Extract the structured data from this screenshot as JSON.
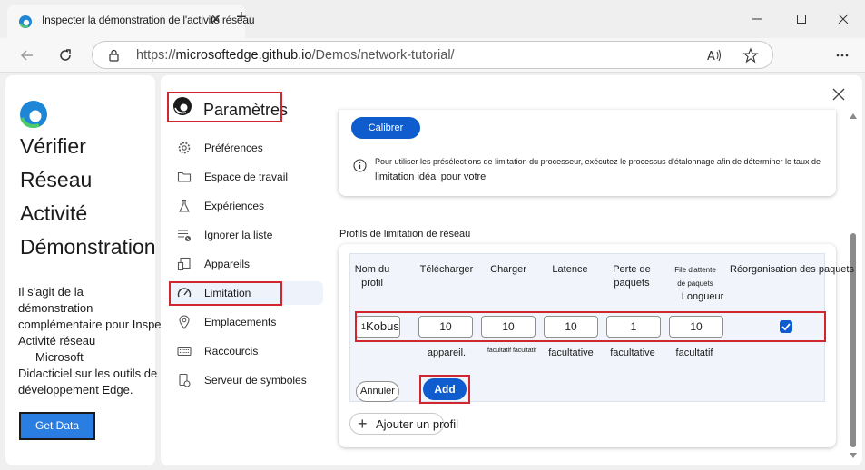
{
  "browser": {
    "tab_title": "Inspecter la démonstration de l'activité réseau",
    "url_prefix": "https://",
    "url_host": "microsoftedge.github.io",
    "url_path": "/Demos/network-tutorial/"
  },
  "demo": {
    "heading_lines": [
      "Vérifier",
      "Réseau",
      "Activité",
      "Démonstration"
    ],
    "description_lines": [
      "Il s'agit de la",
      "démonstration",
      "complémentaire pour Inspect",
      "Activité réseau",
      "Microsoft",
      "Didacticiel sur les outils de",
      "développement Edge."
    ],
    "get_data_label": "Get Data"
  },
  "settings": {
    "title": "Paramètres",
    "nav": [
      {
        "label": "Préférences",
        "icon": "gear-icon"
      },
      {
        "label": "Espace de travail",
        "icon": "folder-icon"
      },
      {
        "label": "Expériences",
        "icon": "flask-icon"
      },
      {
        "label": "Ignorer la liste",
        "icon": "ignore-list-icon"
      },
      {
        "label": "Appareils",
        "icon": "devices-icon"
      },
      {
        "label": "Limitation",
        "icon": "speedometer-icon"
      },
      {
        "label": "Emplacements",
        "icon": "location-pin-icon"
      },
      {
        "label": "Raccourcis",
        "icon": "keyboard-icon"
      },
      {
        "label": "Serveur de symboles",
        "icon": "symbol-server-icon"
      }
    ],
    "active_nav": "Limitation"
  },
  "cpu": {
    "calibrate_label": "Calibrer",
    "info_line1": "Pour utiliser les présélections de limitation du processeur, exécutez le processus d'étalonnage afin de déterminer le taux de",
    "info_line2": "limitation idéal pour votre"
  },
  "network_profiles": {
    "heading": "Profils de limitation de réseau",
    "columns": {
      "name_1": "Nom du",
      "name_2": "profil",
      "download": "Télécharger",
      "upload": "Charger",
      "latency": "Latence",
      "loss_1": "Perte de",
      "loss_2": "paquets",
      "queue_1": "File d'attente",
      "queue_2": "de paquets",
      "queue_3": "Longueur",
      "reorder": "Réorganisation des paquets"
    },
    "row": {
      "name_prefix": "1",
      "name": "Kobus",
      "download": "10",
      "upload": "10",
      "latency": "10",
      "packet_loss": "1",
      "queue_length": "10",
      "reorder": true
    },
    "under_labels": {
      "download": "appareil.",
      "upload": "facultatif facultatif",
      "latency": "facultative",
      "loss": "facultative",
      "queue": "facultatif"
    },
    "cancel_label": "Annuler",
    "add_label": "Add",
    "add_profile_label": "Ajouter un profil"
  }
}
